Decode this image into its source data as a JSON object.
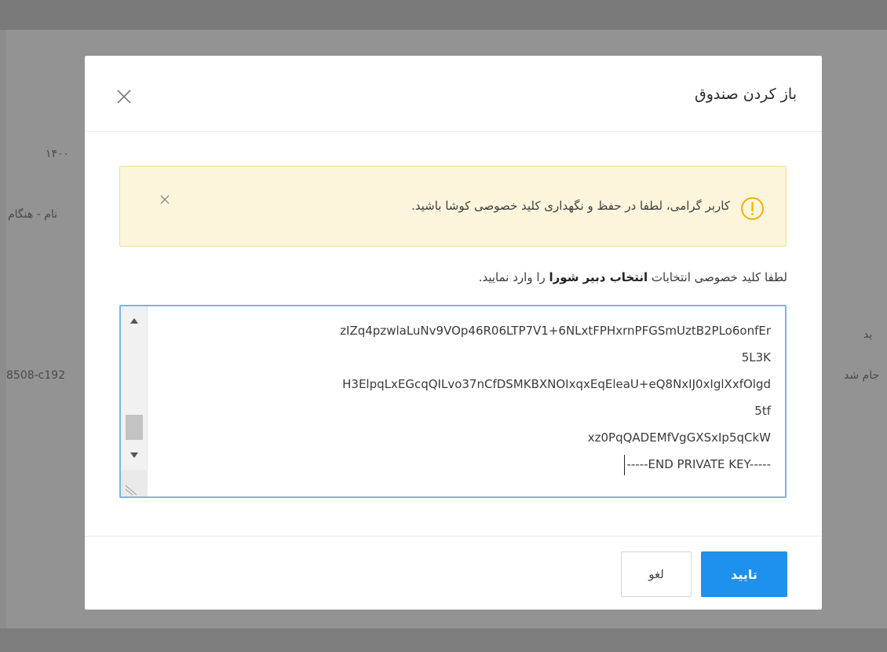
{
  "background": {
    "fragments": [
      "۱۴۰۰",
      "نام - هنگام",
      "ید",
      "8508-c192",
      "جام شد"
    ]
  },
  "modal": {
    "title": "باز کردن صندوق",
    "alert": {
      "text": "کاربر گرامی، لطفا در حفظ و نگهداری کلید خصوصی کوشا باشید."
    },
    "instruction": {
      "prefix": "لطفا کلید خصوصی انتخابات",
      "bold": "انتخاب دبیر شورا",
      "suffix": "را وارد نمایید."
    },
    "key_lines": [
      "zIZq4pzwlaLuNv9VOp46R06LTP7V1+6NLxtFPHxrnPFGSmUztB2PLo6onfEr",
      "5L3K",
      "H3ElpqLxEGcqQILvo37nCfDSMKBXNOIxqxEqEleaU+eQ8NxIJ0xIglXxfOlgd",
      "5tf",
      "xz0PqQADEMfVgGXSxIp5qCkW",
      "-----END PRIVATE KEY-----"
    ],
    "buttons": {
      "confirm": "تایید",
      "cancel": "لغو"
    }
  },
  "colors": {
    "primary": "#1e90ee",
    "alert_bg": "#fcf5dc",
    "alert_border": "#f2dd95",
    "alert_icon": "#f0b400",
    "focus_border": "#7db3e8"
  }
}
